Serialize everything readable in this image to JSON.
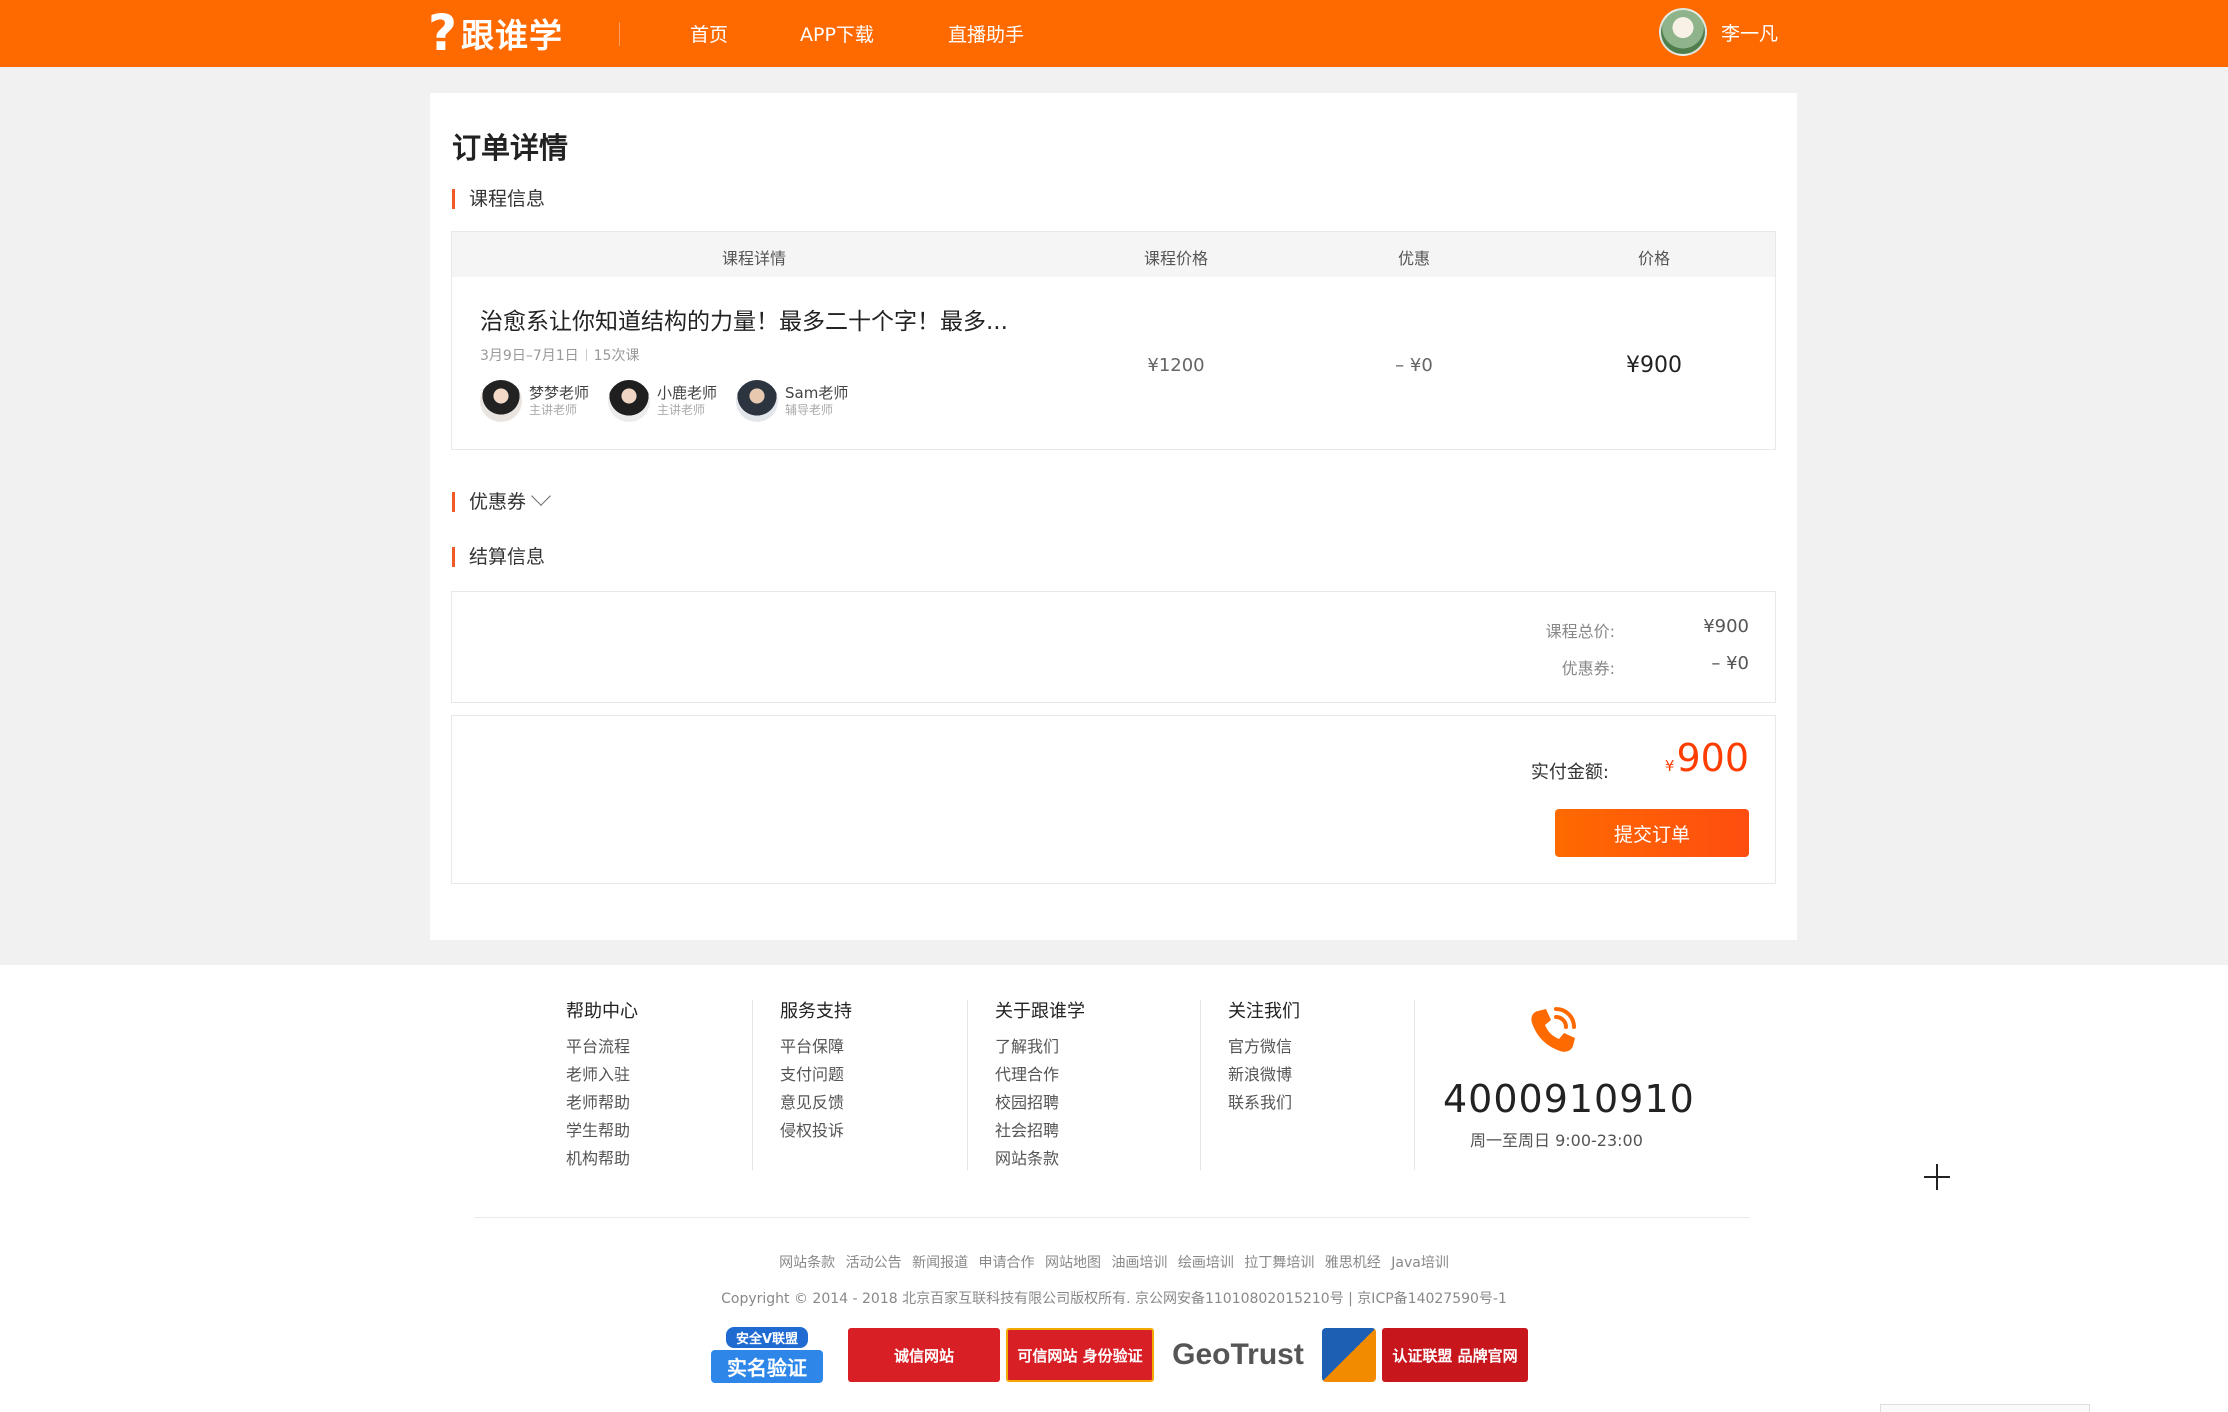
{
  "header": {
    "logo_mark": "?",
    "logo_text": "跟谁学",
    "nav": [
      "首页",
      "APP下载",
      "直播助手"
    ],
    "user_name": "李一凡"
  },
  "order": {
    "page_title": "订单详情",
    "course_section_title": "课程信息",
    "table_headers": [
      "课程详情",
      "课程价格",
      "优惠",
      "价格"
    ],
    "course": {
      "name": "治愈系让你知道结构的力量！最多二十个字！最多...",
      "dates": "3月9日–7月1日",
      "lessons": "15次课",
      "price": "¥1200",
      "discount": "– ¥0",
      "final_price": "¥900",
      "teachers": [
        {
          "name": "梦梦老师",
          "role": "主讲老师"
        },
        {
          "name": "小鹿老师",
          "role": "主讲老师"
        },
        {
          "name": "Sam老师",
          "role": "辅导老师"
        }
      ]
    },
    "coupon_section_title": "优惠券",
    "settle_section_title": "结算信息",
    "summary": {
      "total_label": "课程总价:",
      "total_value": "¥900",
      "coupon_label": "优惠券:",
      "coupon_value": "– ¥0"
    },
    "payment": {
      "label": "实付金额:",
      "currency": "¥",
      "amount": "900",
      "submit_label": "提交订单"
    }
  },
  "footer": {
    "columns": [
      {
        "title": "帮助中心",
        "links": [
          "平台流程",
          "老师入驻",
          "老师帮助",
          "学生帮助",
          "机构帮助"
        ]
      },
      {
        "title": "服务支持",
        "links": [
          "平台保障",
          "支付问题",
          "意见反馈",
          "侵权投诉"
        ]
      },
      {
        "title": "关于跟谁学",
        "links": [
          "了解我们",
          "代理合作",
          "校园招聘",
          "社会招聘",
          "网站条款"
        ]
      },
      {
        "title": "关注我们",
        "links": [
          "官方微信",
          "新浪微博",
          "联系我们"
        ]
      }
    ],
    "phone": "4000910910",
    "hours": "周一至周日 9:00-23:00",
    "bottom_links": [
      "网站条款",
      "活动公告",
      "新闻报道",
      "申请合作",
      "网站地图",
      "油画培训",
      "绘画培训",
      "拉丁舞培训",
      "雅思机经",
      "Java培训"
    ],
    "copyright": "Copyright © 2014 - 2018 北京百家互联科技有限公司版权所有. 京公网安备11010802015210号 | 京ICP备14027590号-1",
    "badges": {
      "b1_top": "安全V联盟",
      "b1_main": "实名验证",
      "b2": "诚信网站",
      "b3": "可信网站 身份验证",
      "b4": "GeoTrust",
      "b6": "认证联盟 品牌官网"
    }
  },
  "colors": {
    "brand": "#ff6a00",
    "accent_red": "#ff3d00"
  },
  "icons": [
    "logo-icon",
    "chevron-down-icon",
    "phone-icon",
    "plus-icon"
  ]
}
